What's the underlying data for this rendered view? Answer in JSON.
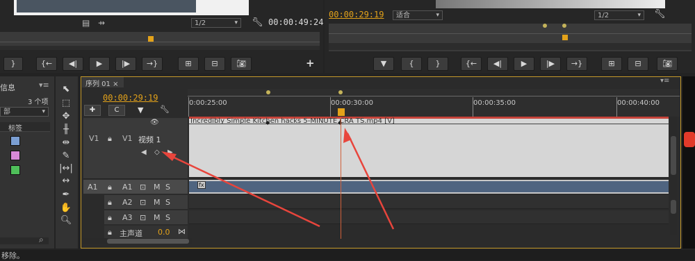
{
  "source_monitor": {
    "zoom": "1/2",
    "timecode": "00:00:49:24"
  },
  "program_monitor": {
    "timecode": "00:00:29:19",
    "fit": "适合",
    "zoom": "1/2"
  },
  "project_panel": {
    "tab_label": "信息",
    "item_count": "3 个项",
    "dropdown_value": "部",
    "column_label": "标签",
    "label_colors": [
      "#7b9fd3",
      "#d98ad9",
      "#4fbf5a"
    ]
  },
  "timeline": {
    "tab_label": "序列 01 ×",
    "playhead_timecode": "00:00:29:19",
    "ruler_labels": [
      "0:00:25:00",
      "00:00:30:00",
      "00:00:35:00",
      "00:00:40:00"
    ],
    "video_track": {
      "source_label": "V1",
      "target_label": "V1",
      "name": "视频 1",
      "clip_name": "Incredibly Simple Kitchen hacks   5-MINUTE CRA   TS.mp4 [V]"
    },
    "audio_tracks": [
      {
        "source": "A1",
        "target": "A1",
        "m": "M",
        "s": "S"
      },
      {
        "source": "",
        "target": "A2",
        "m": "M",
        "s": "S"
      },
      {
        "source": "",
        "target": "A3",
        "m": "M",
        "s": "S"
      }
    ],
    "master_label": "主声道",
    "master_value": "0.0"
  },
  "status_bar": {
    "text": "移除。"
  },
  "colors": {
    "accent": "#e3a21a",
    "arrow": "#e8453c",
    "audio_clip": "#4f6480",
    "video_clip": "#d6d6d6"
  }
}
